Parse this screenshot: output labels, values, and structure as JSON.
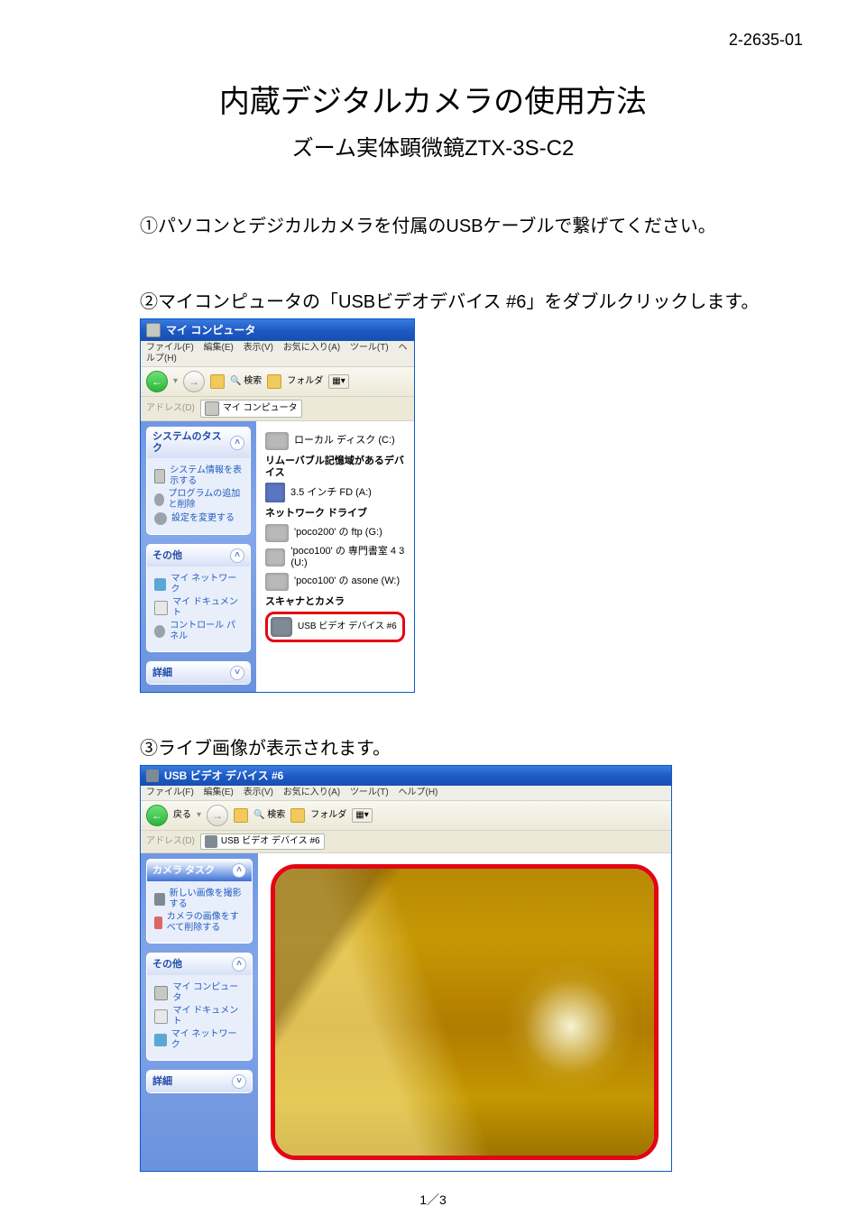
{
  "doc_code": "2-2635-01",
  "title_main": "内蔵デジタルカメラの使用方法",
  "title_sub": "ズーム実体顕微鏡ZTX-3S-C2",
  "step1": "①パソコンとデジカルカメラを付属のUSBケーブルで繋げてください。",
  "step2": "②マイコンピュータの「USBビデオデバイス #6」をダブルクリックします。",
  "step3": "③ライブ画像が表示されます。",
  "page_number": "1／3",
  "xp1": {
    "title": "マイ コンピュータ",
    "menu": {
      "file": "ファイル(F)",
      "edit": "編集(E)",
      "view": "表示(V)",
      "fav": "お気に入り(A)",
      "tools": "ツール(T)",
      "help": "ヘルプ(H)"
    },
    "toolbar": {
      "back_glyph": "←",
      "search": "検索",
      "folders": "フォルダ"
    },
    "address": {
      "label": "アドレス(D)",
      "value": "マイ コンピュータ"
    },
    "side": {
      "tasks": {
        "header": "システムのタスク",
        "i1": "システム情報を表示する",
        "i2": "プログラムの追加と削除",
        "i3": "設定を変更する"
      },
      "other": {
        "header": "その他",
        "i1": "マイ ネットワーク",
        "i2": "マイ ドキュメント",
        "i3": "コントロール パネル"
      },
      "details": {
        "header": "詳細"
      }
    },
    "content": {
      "disk_label": "ローカル ディスク (C:)",
      "removable_header": "リムーバブル記憶域があるデバイス",
      "floppy_label": "3.5 インチ FD (A:)",
      "netdrive_header": "ネットワーク ドライブ",
      "nd1": "'poco200' の ftp (G:)",
      "nd2": "'poco100' の 専門書室 4 3 (U:)",
      "nd3": "'poco100' の asone (W:)",
      "scanner_header": "スキャナとカメラ",
      "usb_video": "USB ビデオ デバイス #6"
    }
  },
  "xp2": {
    "title": "USB ビデオ デバイス #6",
    "menu": {
      "file": "ファイル(F)",
      "edit": "編集(E)",
      "view": "表示(V)",
      "fav": "お気に入り(A)",
      "tools": "ツール(T)",
      "help": "ヘルプ(H)"
    },
    "toolbar": {
      "back": "戻る",
      "search": "検索",
      "folders": "フォルダ"
    },
    "address": {
      "label": "アドレス(D)",
      "value": "USB ビデオ デバイス #6"
    },
    "side": {
      "camera": {
        "header": "カメラ タスク",
        "i1": "新しい画像を撮影する",
        "i2": "カメラの画像をすべて削除する"
      },
      "other": {
        "header": "その他",
        "i1": "マイ コンピュータ",
        "i2": "マイ ドキュメント",
        "i3": "マイ ネットワーク"
      },
      "details": {
        "header": "詳細"
      }
    }
  }
}
